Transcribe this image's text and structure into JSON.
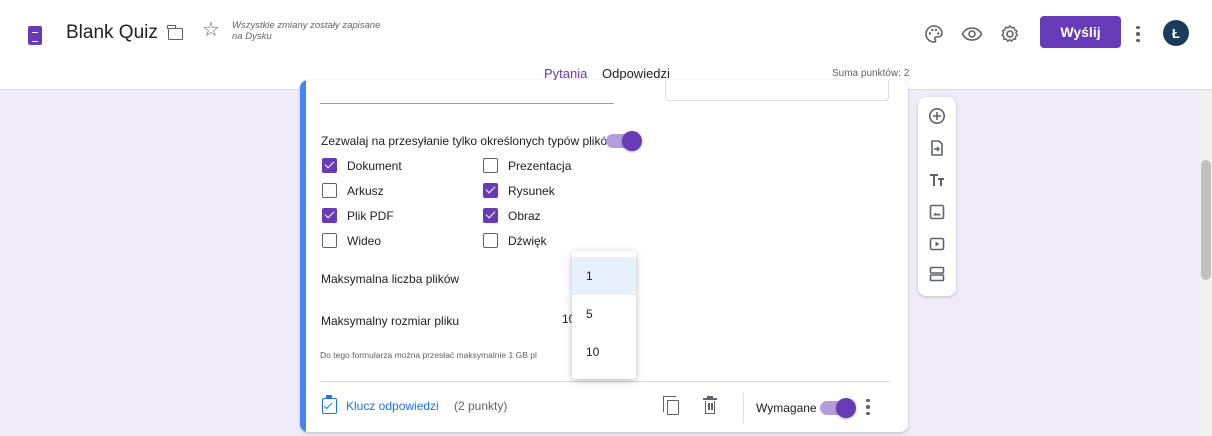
{
  "app": {
    "title": "Blank Quiz",
    "save_status": "Wszystkie zmiany zostały zapisane na Dysku",
    "send_label": "Wyślij",
    "avatar_initial": "Ł",
    "accent_color": "#673ab7"
  },
  "tabs": [
    {
      "label": "Pytania",
      "active": true
    },
    {
      "label": "Odpowiedzi",
      "active": false
    }
  ],
  "points_total": "Suma punktów: 2",
  "question": {
    "filetype_toggle_label": "Zezwalaj na przesyłanie tylko określonych typów plików",
    "filetype_toggle_on": true,
    "file_types": [
      {
        "label": "Dokument",
        "checked": true
      },
      {
        "label": "Prezentacja",
        "checked": false
      },
      {
        "label": "Arkusz",
        "checked": false
      },
      {
        "label": "Rysunek",
        "checked": true
      },
      {
        "label": "Plik PDF",
        "checked": true
      },
      {
        "label": "Obraz",
        "checked": true
      },
      {
        "label": "Wideo",
        "checked": false
      },
      {
        "label": "Dźwięk",
        "checked": false
      }
    ],
    "max_files_label": "Maksymalna liczba plików",
    "max_size_label": "Maksymalny rozmiar pliku",
    "max_size_value": "10",
    "quota_note": "Do tego formularza można przesłać maksymalnie 1 GB pl",
    "answer_key_label": "Klucz odpowiedzi",
    "points_label": "(2 punkty)",
    "required_label": "Wymagane",
    "required_on": true
  },
  "dropdown": {
    "options": [
      "1",
      "5",
      "10"
    ],
    "selected": "1"
  },
  "toolbar": {
    "icons": [
      "add-question-icon",
      "import-questions-icon",
      "add-title-icon",
      "add-image-icon",
      "add-video-icon",
      "add-section-icon"
    ]
  }
}
